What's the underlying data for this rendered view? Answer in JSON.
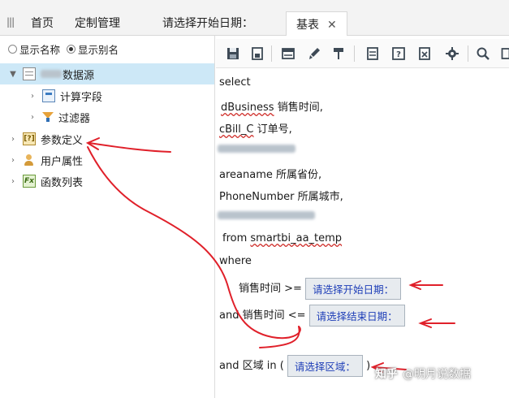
{
  "topbar": {
    "tabs": [
      {
        "label": "首页"
      },
      {
        "label": "定制管理"
      },
      {
        "label": "请选择开始日期："
      },
      {
        "label": "基表"
      }
    ],
    "close_glyph": "✕"
  },
  "left_panel": {
    "radio_show_name": "显示名称",
    "radio_show_alias": "显示别名",
    "selected_radio": "显示别名",
    "tree": [
      {
        "label": "数据源",
        "icon": "datasource-icon",
        "expanded": true,
        "selected": true,
        "masked_prefix": true
      },
      {
        "label": "计算字段",
        "icon": "calculated-field-icon"
      },
      {
        "label": "过滤器",
        "icon": "filter-icon"
      },
      {
        "label": "参数定义",
        "icon": "parameter-icon"
      },
      {
        "label": "用户属性",
        "icon": "user-attribute-icon"
      },
      {
        "label": "函数列表",
        "icon": "function-list-icon"
      }
    ]
  },
  "toolbar": {
    "icons": [
      "save-icon",
      "save-as-icon",
      "table-icon",
      "brush-icon",
      "pin-icon",
      "grid-icon",
      "help-icon",
      "export-icon",
      "gear-icon",
      "search-icon"
    ]
  },
  "editor": {
    "line1": "select",
    "line2_code": "dBusiness",
    "line2_alias": " 销售时间,",
    "line3_code": "cBill_C",
    "line3_alias": " 订单号,",
    "line5": "areaname 所属省份,",
    "line6": "PhoneNumber 所属城市,",
    "line8_kw": "from ",
    "line8_table": "smartbi_aa_temp",
    "line9": "where",
    "cond1_label": "销售时间 >=",
    "cond1_param": "请选择开始日期：",
    "cond2_label": "and 销售时间 <=",
    "cond2_param": "请选择结束日期：",
    "cond3_label": "and  区域 in (",
    "cond3_param": "请选择区域：",
    "cond3_close": ")"
  },
  "watermark": {
    "zh": "知乎",
    "handle": "@明月说数据"
  },
  "colors": {
    "annotation": "#e0202a",
    "selected_row": "#cde8f7",
    "param_text": "#1f3fb8"
  }
}
